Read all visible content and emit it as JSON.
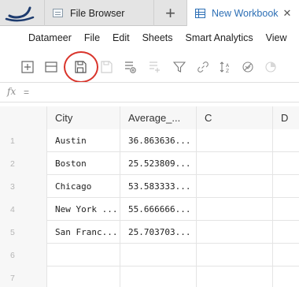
{
  "tabs": {
    "file_browser": "File Browser",
    "add": "+",
    "workbook": "New Workbook",
    "close": "✕"
  },
  "menu": [
    "Datameer",
    "File",
    "Edit",
    "Sheets",
    "Smart Analytics",
    "View"
  ],
  "toolbar": {
    "icons": [
      "add-sheet-icon",
      "remove-sheet-icon",
      "save-icon",
      "copy-sheet-icon",
      "add-sheet-right-icon",
      "sheet-plus-icon",
      "filter-icon",
      "link-icon",
      "sort-az-icon",
      "no-filter-icon",
      "timer-icon"
    ],
    "highlight_color": "#d9342b"
  },
  "formula": {
    "fx": "fx",
    "eq": "="
  },
  "grid": {
    "columns": [
      "City",
      "Average_...",
      "C",
      "D"
    ],
    "rows": [
      {
        "num": "1",
        "city": "Austin",
        "avg": "36.863636..."
      },
      {
        "num": "2",
        "city": "Boston",
        "avg": "25.523809..."
      },
      {
        "num": "3",
        "city": "Chicago",
        "avg": "53.583333..."
      },
      {
        "num": "4",
        "city": "New York ...",
        "avg": "55.666666..."
      },
      {
        "num": "5",
        "city": "San Franc...",
        "avg": "25.703703..."
      },
      {
        "num": "6",
        "city": "",
        "avg": ""
      },
      {
        "num": "7",
        "city": "",
        "avg": ""
      }
    ]
  },
  "colors": {
    "accent": "#2d6fb5",
    "highlight": "#d9342b"
  }
}
